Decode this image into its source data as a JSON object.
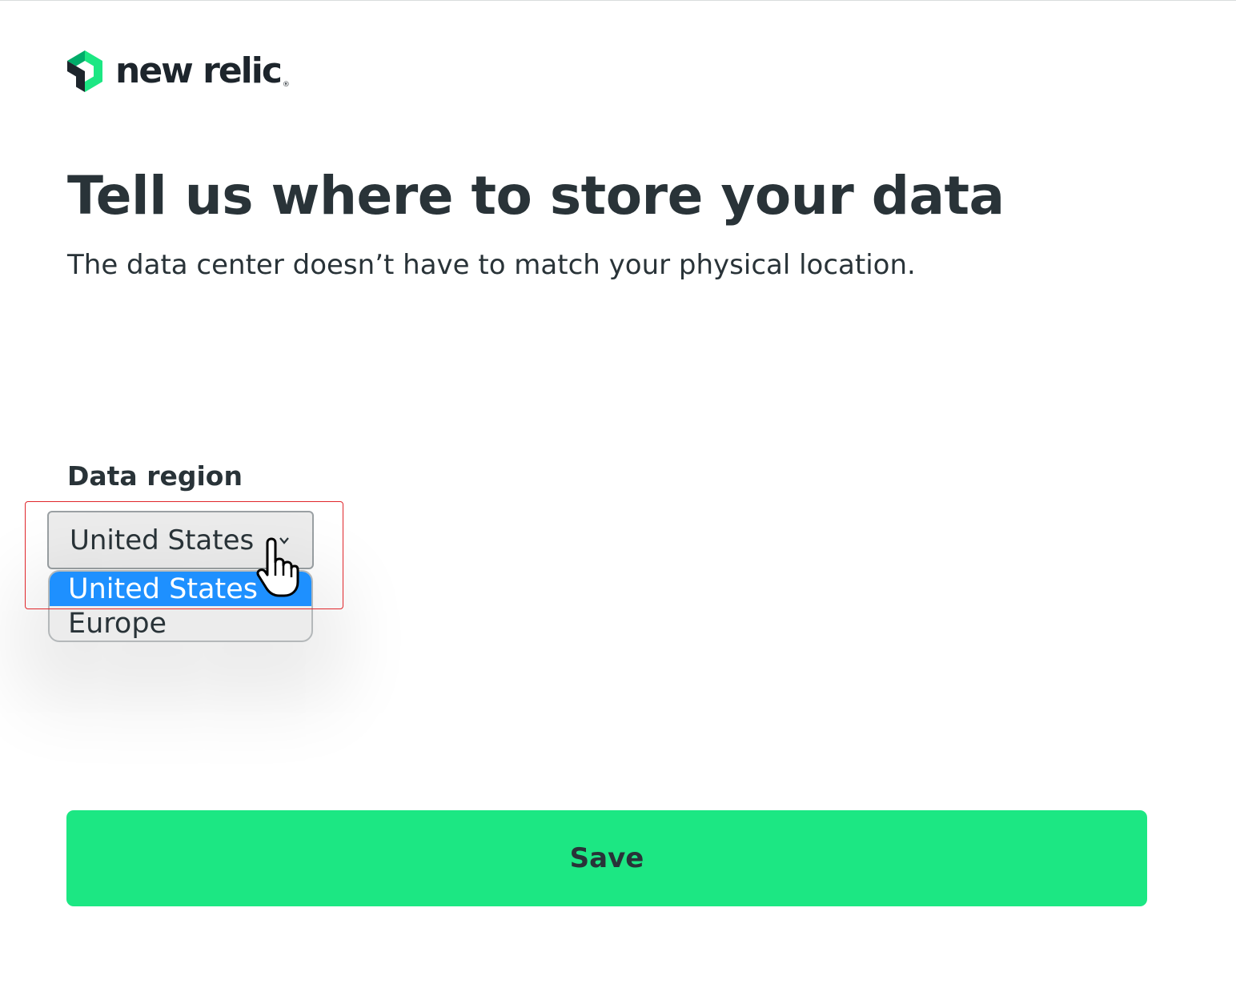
{
  "brand": {
    "name": "new relic",
    "registered_mark": "®",
    "accent_color": "#1ce783",
    "logo_icon": "new-relic-logo-icon"
  },
  "main": {
    "title": "Tell us where to store your data",
    "subtitle": "The data center doesn’t have to match your physical location."
  },
  "region_field": {
    "label": "Data region",
    "selected_value": "United States",
    "options": [
      "United States",
      "Europe"
    ],
    "highlighted_option": "United States",
    "expand_icon": "chevron-down-icon"
  },
  "save_button": {
    "label": "Save"
  },
  "colors": {
    "highlight_outline": "#e0262b",
    "option_selected_bg": "#1e90ff",
    "text": "#293338"
  }
}
